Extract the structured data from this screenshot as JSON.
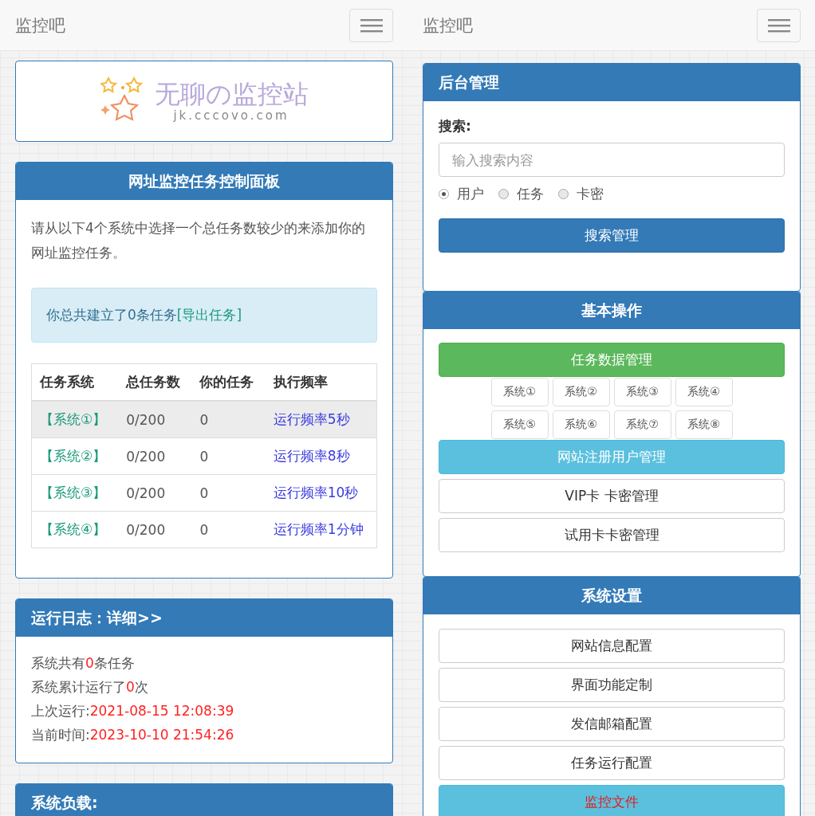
{
  "left": {
    "navbar": {
      "brand": "监控吧"
    },
    "logo": {
      "title": "无聊の监控站",
      "domain": "jk.cccovo.com"
    },
    "task_panel": {
      "title": "网址监控任务控制面板",
      "intro": "请从以下4个系统中选择一个总任务数较少的来添加你的网址监控任务。",
      "notice": {
        "text": "你总共建立了0条任务 ",
        "link": "[导出任务]"
      },
      "table": {
        "columns": [
          "任务系统",
          "总任务数",
          "你的任务",
          "执行频率"
        ],
        "rows": [
          {
            "system": "【系统①】",
            "total": "0/200",
            "mine": "0",
            "frequency": "运行频率5秒",
            "highlighted": true
          },
          {
            "system": "【系统②】",
            "total": "0/200",
            "mine": "0",
            "frequency": "运行频率8秒",
            "highlighted": false
          },
          {
            "system": "【系统③】",
            "total": "0/200",
            "mine": "0",
            "frequency": "运行频率10秒",
            "highlighted": false
          },
          {
            "system": "【系统④】",
            "total": "0/200",
            "mine": "0",
            "frequency": "运行频率1分钟",
            "highlighted": false
          }
        ]
      }
    },
    "log_panel": {
      "title": "运行日志：详细>>",
      "lines": [
        {
          "label": "系统共有",
          "value": "0",
          "suffix": "条任务"
        },
        {
          "label": "系统累计运行了",
          "value": "0",
          "suffix": "次"
        },
        {
          "label": "上次运行:",
          "value": "2021-08-15 12:08:39"
        },
        {
          "label": "当前时间:",
          "value": "2023-10-10 21:54:26"
        }
      ]
    },
    "load_panel": {
      "title": "系统负载:"
    }
  },
  "right": {
    "navbar": {
      "brand": "监控吧"
    },
    "admin_panel": {
      "title": "后台管理",
      "search_label": "搜索:",
      "search": {
        "placeholder": "输入搜索内容"
      },
      "radios": [
        {
          "label": "用户",
          "selected": true
        },
        {
          "label": "任务",
          "selected": false
        },
        {
          "label": "卡密",
          "selected": false
        }
      ],
      "button": "搜索管理"
    },
    "basic_panel": {
      "title": "基本操作",
      "primary": {
        "label": "任务数据管理",
        "kind": "success"
      },
      "systems": [
        "系统①",
        "系统②",
        "系统③",
        "系统④",
        "系统⑤",
        "系统⑥",
        "系统⑦",
        "系统⑧"
      ],
      "actions": [
        {
          "label": "网站注册用户管理",
          "kind": "info"
        },
        {
          "label": "VIP卡 卡密管理",
          "kind": "default"
        },
        {
          "label": "试用卡卡密管理",
          "kind": "default"
        }
      ]
    },
    "settings_panel": {
      "title": "系统设置",
      "actions": [
        {
          "label": "网站信息配置",
          "kind": "default"
        },
        {
          "label": "界面功能定制",
          "kind": "default"
        },
        {
          "label": "发信邮箱配置",
          "kind": "default"
        },
        {
          "label": "任务运行配置",
          "kind": "default"
        },
        {
          "label": "监控文件",
          "kind": "alert"
        }
      ]
    }
  }
}
